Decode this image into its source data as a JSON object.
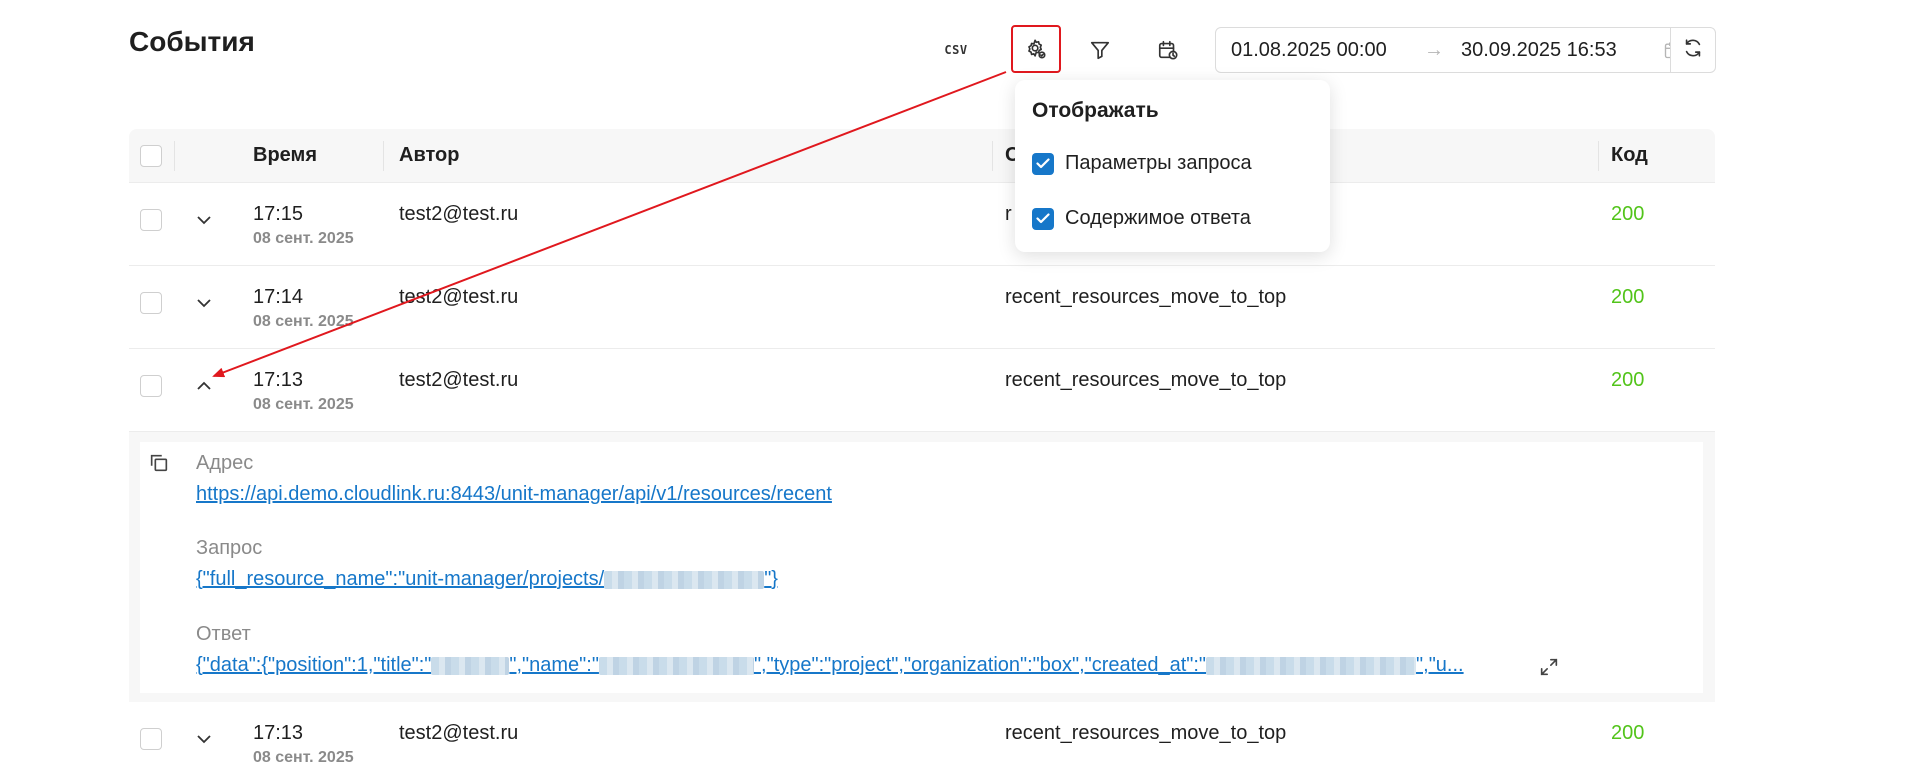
{
  "page": {
    "title": "События"
  },
  "toolbar": {
    "csv_label": "CSV",
    "date_from": "01.08.2025 00:00",
    "date_arrow": "→",
    "date_to": "30.09.2025 16:53"
  },
  "table": {
    "columns": {
      "time": "Время",
      "author": "Автор",
      "operation": "С",
      "code": "Код"
    },
    "rows": [
      {
        "time": "17:15",
        "date": "08 сент. 2025",
        "author": "test2@test.ru",
        "operation": "r",
        "code": "200",
        "expanded": false
      },
      {
        "time": "17:14",
        "date": "08 сент. 2025",
        "author": "test2@test.ru",
        "operation": "recent_resources_move_to_top",
        "code": "200",
        "expanded": false
      },
      {
        "time": "17:13",
        "date": "08 сент. 2025",
        "author": "test2@test.ru",
        "operation": "recent_resources_move_to_top",
        "code": "200",
        "expanded": true
      },
      {
        "time": "17:13",
        "date": "08 сент. 2025",
        "author": "test2@test.ru",
        "operation": "recent_resources_move_to_top",
        "code": "200",
        "expanded": false
      }
    ]
  },
  "details": {
    "address_label": "Адрес",
    "address_value": "https://api.demo.cloudlink.ru:8443/unit-manager/api/v1/resources/recent",
    "request_label": "Запрос",
    "request_prefix": "{\"full_resource_name\":\"unit-manager/projects/",
    "request_suffix": "\"}",
    "response_label": "Ответ",
    "response_part1": "{\"data\":{\"position\":1,\"title\":\"",
    "response_part2": "\",\"name\":\"",
    "response_part3": "\",\"type\":\"project\",\"organization\":\"box\",\"created_at\":\"",
    "response_part4": "\",\"u..."
  },
  "popover": {
    "title": "Отображать",
    "options": [
      {
        "label": "Параметры запроса",
        "checked": true
      },
      {
        "label": "Содержимое ответа",
        "checked": true
      }
    ]
  },
  "colors": {
    "accent": "#1677c9",
    "success": "#52c41a",
    "annotation": "#e0181e"
  }
}
